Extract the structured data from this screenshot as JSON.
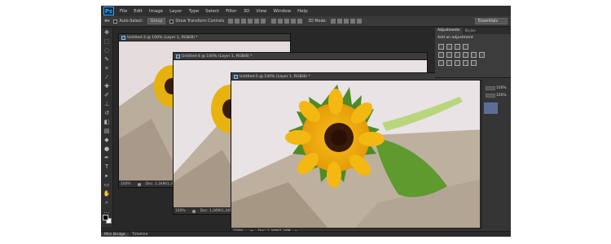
{
  "app": {
    "logo": "Ps"
  },
  "menu": [
    "File",
    "Edit",
    "Image",
    "Layer",
    "Type",
    "Select",
    "Filter",
    "3D",
    "View",
    "Window",
    "Help"
  ],
  "options": {
    "auto_select_label": "Auto-Select:",
    "auto_select_value": "Group",
    "transform_label": "Show Transform Controls",
    "mode_label": "3D Mode:",
    "workspace": "Essentials"
  },
  "tools": [
    {
      "icon": "move-tool-icon",
      "glyph": "✥"
    },
    {
      "icon": "marquee-tool-icon",
      "glyph": "⬚"
    },
    {
      "icon": "lasso-tool-icon",
      "glyph": "◌"
    },
    {
      "icon": "quick-select-tool-icon",
      "glyph": "✎"
    },
    {
      "icon": "crop-tool-icon",
      "glyph": "⌗"
    },
    {
      "icon": "eyedropper-tool-icon",
      "glyph": "⁄"
    },
    {
      "icon": "healing-tool-icon",
      "glyph": "✚"
    },
    {
      "icon": "brush-tool-icon",
      "glyph": "✐"
    },
    {
      "icon": "stamp-tool-icon",
      "glyph": "⊥"
    },
    {
      "icon": "history-brush-icon",
      "glyph": "↺"
    },
    {
      "icon": "eraser-tool-icon",
      "glyph": "◧"
    },
    {
      "icon": "gradient-tool-icon",
      "glyph": "▤"
    },
    {
      "icon": "blur-tool-icon",
      "glyph": "◆"
    },
    {
      "icon": "dodge-tool-icon",
      "glyph": "●"
    },
    {
      "icon": "pen-tool-icon",
      "glyph": "✒"
    },
    {
      "icon": "type-tool-icon",
      "glyph": "T"
    },
    {
      "icon": "path-select-tool-icon",
      "glyph": "▸"
    },
    {
      "icon": "shape-tool-icon",
      "glyph": "▭"
    },
    {
      "icon": "hand-tool-icon",
      "glyph": "✋"
    },
    {
      "icon": "zoom-tool-icon",
      "glyph": "⌕"
    },
    {
      "icon": "more-tools-icon",
      "glyph": "…"
    }
  ],
  "documents": [
    {
      "title": "Untitled-3 @ 100% (Layer 1, RGB/8) *",
      "zoom": "100%",
      "doc": "Doc: 1,34M/1,34M"
    },
    {
      "title": "Untitled-4 @ 100% (Layer 1, RGB/8) *",
      "zoom": "100%",
      "doc": "Doc: 1,34M/1,34M"
    },
    {
      "title": "Untitled-5 @ 100% (Layer 1, RGB/8) *",
      "zoom": "100%",
      "doc": "Doc: 1,34M/1,34M"
    }
  ],
  "panels": {
    "tabs": [
      "Adjustments",
      "Styles"
    ],
    "adj_title": "Add an adjustment",
    "layer_vals": [
      "100%",
      "100%"
    ]
  },
  "bottom_tabs": [
    "Mini Bridge",
    "Timeline"
  ],
  "colors": {
    "sunflower_petal": "#f2b80e",
    "sunflower_center": "#3a1a08",
    "leaf": "#5a8f2a",
    "backdrop": "#e6e0e0",
    "stone": "#b8ab9a"
  }
}
